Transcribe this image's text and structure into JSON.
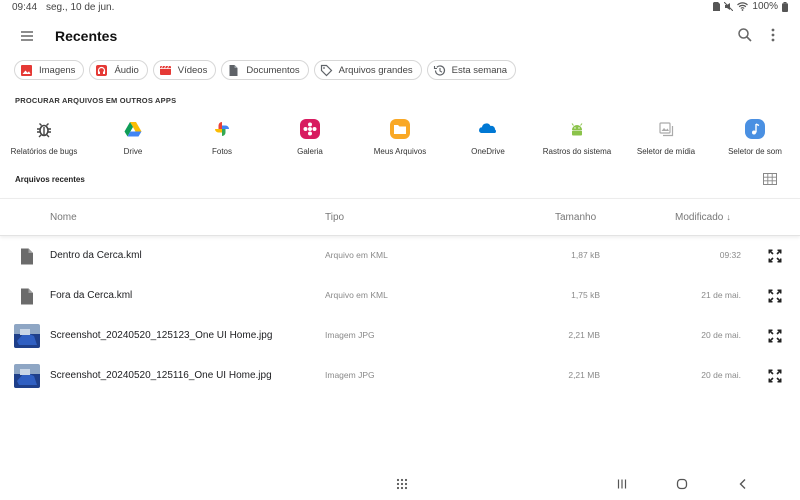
{
  "status_bar": {
    "time": "09:44",
    "date": "seg., 10 de jun.",
    "battery": "100%",
    "icons": [
      "sim-icon",
      "mute-icon",
      "wifi-icon",
      "battery-icon"
    ]
  },
  "app_bar": {
    "title": "Recentes",
    "icons": [
      "menu-icon",
      "search-icon",
      "more-vert-icon"
    ]
  },
  "filter_chips": [
    {
      "label": "Imagens",
      "icon": "image-icon",
      "color": "#e53935"
    },
    {
      "label": "Áudio",
      "icon": "audio-icon",
      "color": "#e53935"
    },
    {
      "label": "Vídeos",
      "icon": "video-icon",
      "color": "#e53935"
    },
    {
      "label": "Documentos",
      "icon": "document-icon",
      "color": "#5f6368"
    },
    {
      "label": "Arquivos grandes",
      "icon": "tag-icon",
      "color": "#5f6368"
    },
    {
      "label": "Esta semana",
      "icon": "history-icon",
      "color": "#5f6368"
    }
  ],
  "other_apps": {
    "heading": "PROCURAR ARQUIVOS EM OUTROS APPS",
    "items": [
      {
        "label": "Relatórios de bugs",
        "icon": "bug-icon"
      },
      {
        "label": "Drive",
        "icon": "google-drive-icon"
      },
      {
        "label": "Fotos",
        "icon": "google-photos-icon"
      },
      {
        "label": "Galeria",
        "icon": "gallery-icon"
      },
      {
        "label": "Meus Arquivos",
        "icon": "folder-icon"
      },
      {
        "label": "OneDrive",
        "icon": "onedrive-icon"
      },
      {
        "label": "Rastros do sistema",
        "icon": "android-icon"
      },
      {
        "label": "Seletor de mídia",
        "icon": "media-picker-icon"
      },
      {
        "label": "Seletor de som",
        "icon": "sound-picker-icon"
      }
    ]
  },
  "recent": {
    "heading": "Arquivos recentes",
    "view_toggle_icon": "grid-view-icon",
    "columns": {
      "name": "Nome",
      "type": "Tipo",
      "size": "Tamanho",
      "modified": "Modificado"
    },
    "sort_icon": "arrow-down-icon",
    "files": [
      {
        "name": "Dentro da Cerca.kml",
        "type": "Arquivo em KML",
        "size": "1,87 kB",
        "modified": "09:32",
        "icon": "file-icon"
      },
      {
        "name": "Fora da Cerca.kml",
        "type": "Arquivo em KML",
        "size": "1,75 kB",
        "modified": "21 de mai.",
        "icon": "file-icon"
      },
      {
        "name": "Screenshot_20240520_125123_One UI Home.jpg",
        "type": "Imagem JPG",
        "size": "2,21 MB",
        "modified": "20 de mai.",
        "icon": "image-thumbnail"
      },
      {
        "name": "Screenshot_20240520_125116_One UI Home.jpg",
        "type": "Imagem JPG",
        "size": "2,21 MB",
        "modified": "20 de mai.",
        "icon": "image-thumbnail"
      }
    ]
  },
  "nav_bar": {
    "icons": [
      "app-drawer-icon",
      "recents-icon",
      "home-icon",
      "back-icon"
    ]
  }
}
